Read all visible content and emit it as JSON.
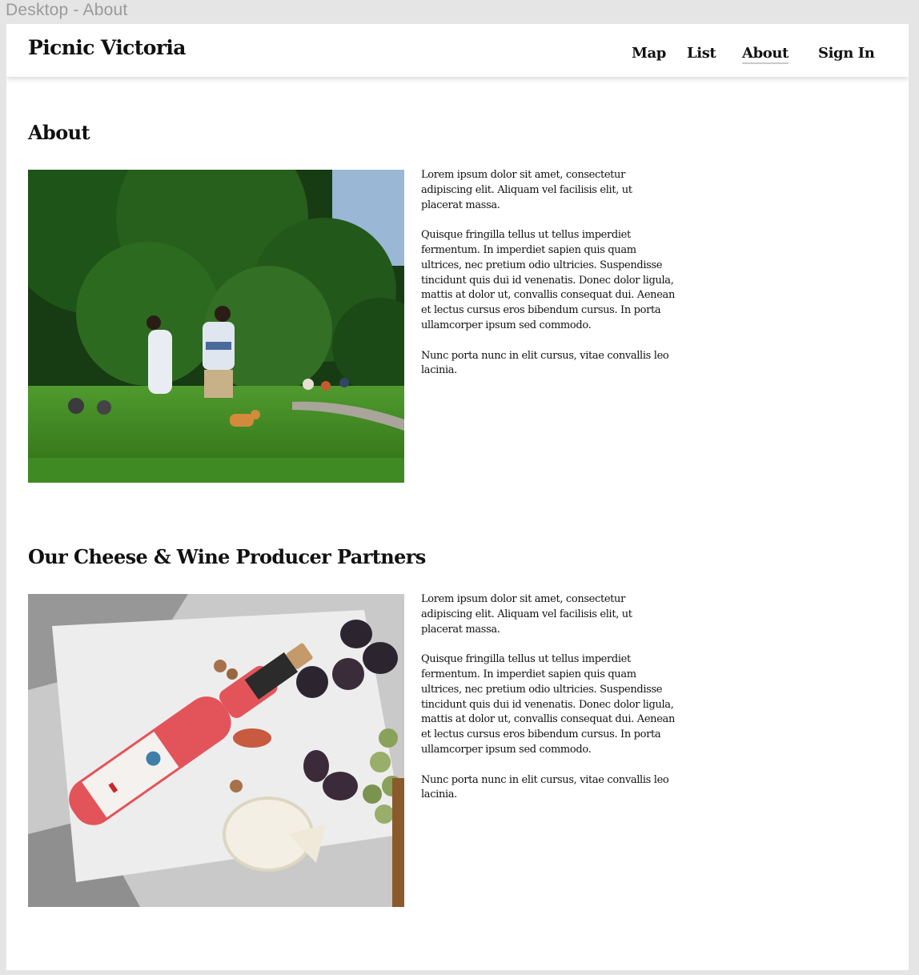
{
  "frame": {
    "label": "Desktop - About"
  },
  "header": {
    "brand": "Picnic Victoria",
    "nav": {
      "map": "Map",
      "list": "List",
      "about": "About",
      "sign_in": "Sign In"
    }
  },
  "about": {
    "title": "About",
    "paragraphs": [
      "Lorem ipsum dolor sit amet, consectetur adipiscing elit. Aliquam vel facilisis elit, ut placerat massa.",
      "Quisque fringilla tellus ut tellus imperdiet fermentum. In imperdiet sapien quis quam ultrices, nec pretium odio ultricies. Suspendisse tincidunt quis dui id venenatis. Donec dolor ligula, mattis at dolor ut, convallis consequat dui. Aenean et lectus cursus eros bibendum cursus. In porta ullamcorper ipsum sed commodo.",
      "Nunc porta nunc in elit cursus, vitae convallis leo lacinia."
    ]
  },
  "partners": {
    "title": "Our Cheese & Wine Producer Partners",
    "paragraphs": [
      "Lorem ipsum dolor sit amet, consectetur adipiscing elit. Aliquam vel facilisis elit, ut placerat massa.",
      "Quisque fringilla tellus ut tellus imperdiet fermentum. In imperdiet sapien quis quam ultrices, nec pretium odio ultricies. Suspendisse tincidunt quis dui id venenatis. Donec dolor ligula, mattis at dolor ut, convallis consequat dui. Aenean et lectus cursus eros bibendum cursus. In porta ullamcorper ipsum sed commodo.",
      "Nunc porta nunc in elit cursus, vitae convallis leo lacinia."
    ]
  },
  "colors": {
    "frame_background": "#e5e5e5",
    "page_background": "#ffffff",
    "text": "#111111",
    "active_underline": "#c9c9c9"
  }
}
